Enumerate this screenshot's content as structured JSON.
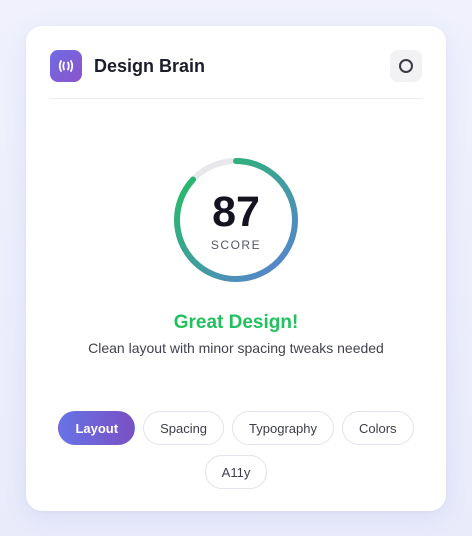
{
  "app": {
    "title": "Design Brain"
  },
  "score": {
    "value": 87,
    "label": "SCORE",
    "max": 100,
    "colors": {
      "track": "#e8e8ec",
      "gradient_start": "#5b7fd8",
      "gradient_end": "#22c05e"
    }
  },
  "result": {
    "verdict": "Great Design!",
    "description": "Clean layout with minor spacing tweaks needed",
    "verdict_color": "#22c05e"
  },
  "tabs": [
    {
      "label": "Layout",
      "active": true
    },
    {
      "label": "Spacing",
      "active": false
    },
    {
      "label": "Typography",
      "active": false
    },
    {
      "label": "Colors",
      "active": false
    },
    {
      "label": "A11y",
      "active": false
    }
  ],
  "icons": {
    "logo": "sound-waves-icon",
    "settings": "ring-icon"
  }
}
